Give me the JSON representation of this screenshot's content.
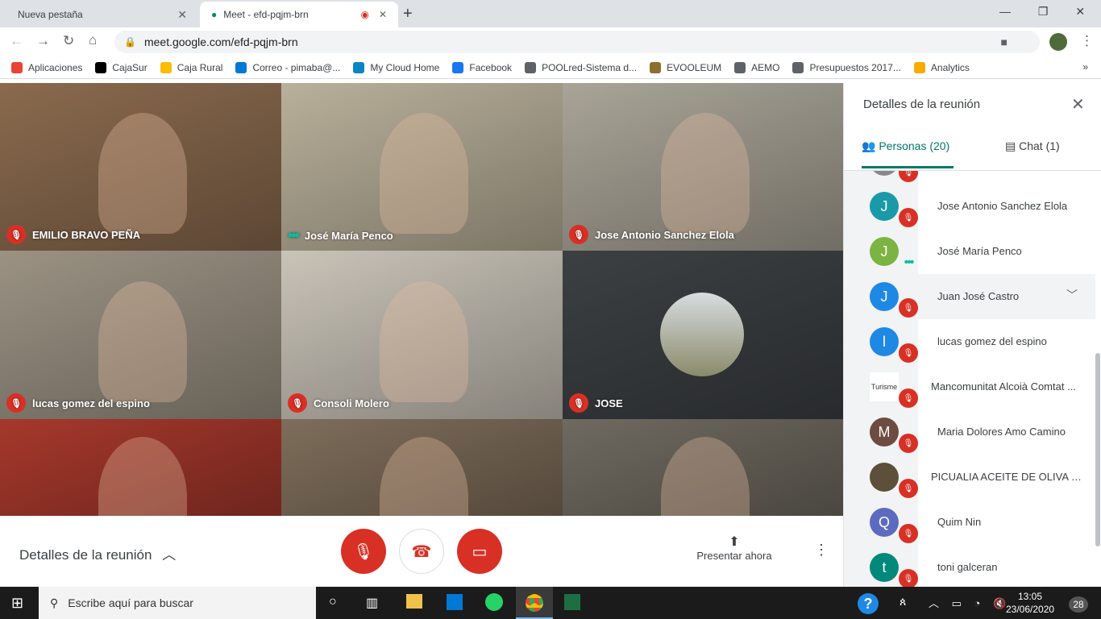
{
  "browser": {
    "tabs": [
      {
        "title": "Nueva pestaña"
      },
      {
        "title": "Meet - efd-pqjm-brn",
        "recording": true
      }
    ],
    "url": "meet.google.com/efd-pqjm-brn",
    "bookmarks": [
      "Aplicaciones",
      "CajaSur",
      "Caja Rural",
      "Correo - pimaba@...",
      "My Cloud Home",
      "Facebook",
      "POOLred-Sistema d...",
      "EVOOLEUM",
      "AEMO",
      "Presupuestos 2017...",
      "Analytics"
    ],
    "bookmark_colors": [
      "#ea4335",
      "#000000",
      "#fbbc04",
      "#0078d4",
      "#0a84c1",
      "#1877f2",
      "#5f6368",
      "#8d6e2e",
      "#5f6368",
      "#5f6368",
      "#f9ab00"
    ]
  },
  "tiles": [
    {
      "name": "EMILIO BRAVO PEÑA",
      "muted": true,
      "bg": "#8a6a4e"
    },
    {
      "name": "José María Penco",
      "muted": false,
      "speaking": true,
      "bg": "#b9b09a"
    },
    {
      "name": "Jose Antonio Sanchez Elola",
      "muted": true,
      "bg": "#a9a497"
    },
    {
      "name": "lucas gomez del espino",
      "muted": true,
      "bg": "#9b9283"
    },
    {
      "name": "Consoli Molero",
      "muted": true,
      "bg": "#c9c3b8"
    },
    {
      "name": "JOSE",
      "muted": true,
      "bg": "#3c4043"
    },
    {
      "name": "",
      "bg": "#a6382c"
    },
    {
      "name": "",
      "bg": "#7e6d5a"
    },
    {
      "name": "",
      "bg": "#6f6a60"
    }
  ],
  "bottom": {
    "details": "Detalles de la reunión",
    "present": "Presentar ahora"
  },
  "panel": {
    "title": "Detalles de la reunión",
    "tab_people": "Personas (20)",
    "tab_chat": "Chat (1)",
    "people": [
      {
        "initial": "J",
        "name": "Jose Antonio Sanchez Elola",
        "color": "#1a9aa8",
        "muted": true
      },
      {
        "initial": "J",
        "name": "José María Penco",
        "color": "#7cb342",
        "muted": false
      },
      {
        "initial": "J",
        "name": "Juan José Castro",
        "color": "#1e88e5",
        "muted": true,
        "hover": true
      },
      {
        "initial": "l",
        "name": "lucas gomez del espino",
        "color": "#1e88e5",
        "muted": true
      },
      {
        "initial": "Turisme",
        "name": "Mancomunitat Alcoià Comtat ...",
        "color": "#ffffff",
        "muted": true
      },
      {
        "initial": "M",
        "name": "Maria Dolores Amo Camino",
        "color": "#6d4c41",
        "muted": true
      },
      {
        "initial": "",
        "name": "PICUALIA ACEITE DE OLIVA VI...",
        "color": "#5d4f3a",
        "muted": true
      },
      {
        "initial": "Q",
        "name": "Quim Nin",
        "color": "#5c6bc0",
        "muted": true
      },
      {
        "initial": "t",
        "name": "toni galceran",
        "color": "#00897b",
        "muted": true
      }
    ]
  },
  "taskbar": {
    "search": "Escribe aquí para buscar",
    "time": "13:05",
    "date": "23/06/2020",
    "notifications": "28"
  }
}
